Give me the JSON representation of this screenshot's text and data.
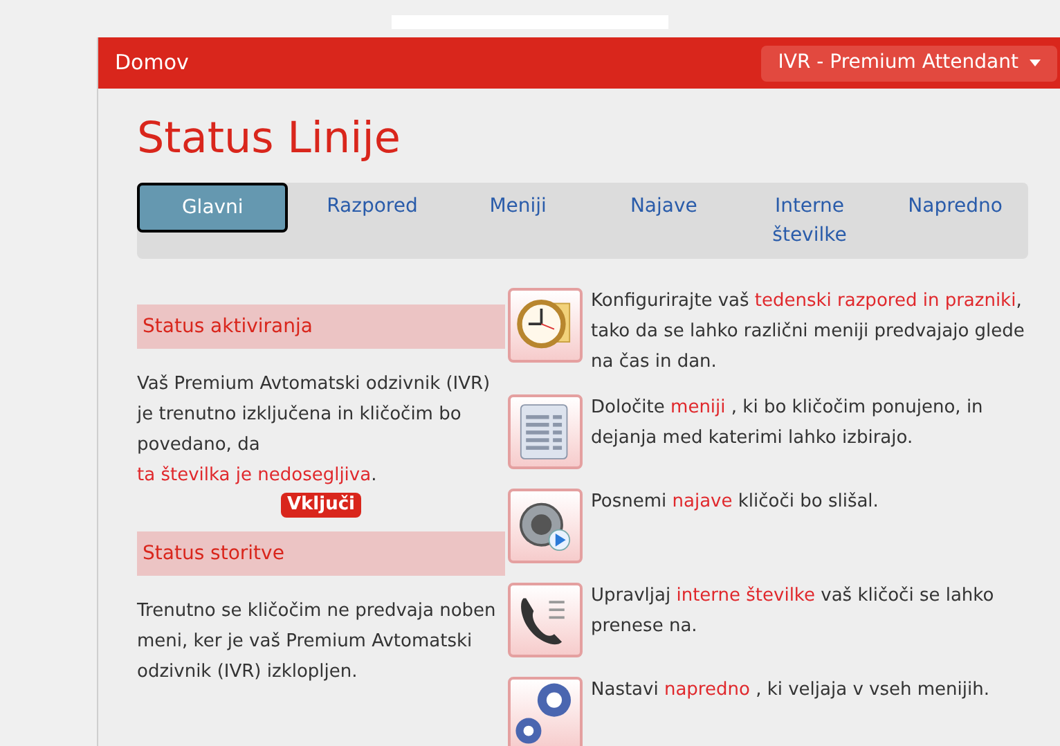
{
  "header": {
    "home": "Domov",
    "product_menu": "IVR - Premium Attendant"
  },
  "title": "Status Linije",
  "tabs": [
    {
      "label": "Glavni",
      "selected": true
    },
    {
      "label": "Razpored",
      "selected": false
    },
    {
      "label": "Meniji",
      "selected": false
    },
    {
      "label": "Najave",
      "selected": false
    },
    {
      "label": "Interne številke",
      "selected": false
    },
    {
      "label": "Napredno",
      "selected": false
    }
  ],
  "sections": [
    {
      "heading": "Status aktiviranja",
      "text": [
        {
          "text": "Vaš Premium Avtomatski odzivnik (IVR) je trenutno izključena in kličočim bo povedano, da ",
          "link": false
        },
        {
          "text": "ta številka je nedosegljiva",
          "link": true
        },
        {
          "text": ".",
          "link": false
        }
      ],
      "button": "Vključi"
    },
    {
      "heading": "Status storitve",
      "text": [
        {
          "text": "Trenutno se kličočim ne predvaja noben meni, ker je vaš Premium Avtomatski odzivnik (IVR) izklopljen.",
          "link": false
        }
      ]
    }
  ],
  "features": [
    {
      "kind": "clock",
      "text": [
        {
          "text": "Konfigurirajte vaš ",
          "link": false
        },
        {
          "text": "tedenski razpored in prazniki",
          "link": true
        },
        {
          "text": ", tako da se lahko različni meniji predvajajo glede na čas in dan.",
          "link": false
        }
      ]
    },
    {
      "kind": "list",
      "text": [
        {
          "text": "Določite ",
          "link": false
        },
        {
          "text": "meniji",
          "link": true
        },
        {
          "text": " , ki bo kličočim ponujeno, in dejanja med katerimi lahko izbirajo.",
          "link": false
        }
      ]
    },
    {
      "kind": "speaker",
      "text": [
        {
          "text": "Posnemi ",
          "link": false
        },
        {
          "text": "najave",
          "link": true
        },
        {
          "text": " kličoči bo slišal.",
          "link": false
        }
      ]
    },
    {
      "kind": "phone",
      "text": [
        {
          "text": "Upravljaj ",
          "link": false
        },
        {
          "text": "interne številke",
          "link": true
        },
        {
          "text": " vaš kličoči se lahko prenese na.",
          "link": false
        }
      ]
    },
    {
      "kind": "gears",
      "text": [
        {
          "text": "Nastavi ",
          "link": false
        },
        {
          "text": "napredno",
          "link": true
        },
        {
          "text": " , ki veljaja v vseh menijih.",
          "link": false
        }
      ]
    }
  ]
}
